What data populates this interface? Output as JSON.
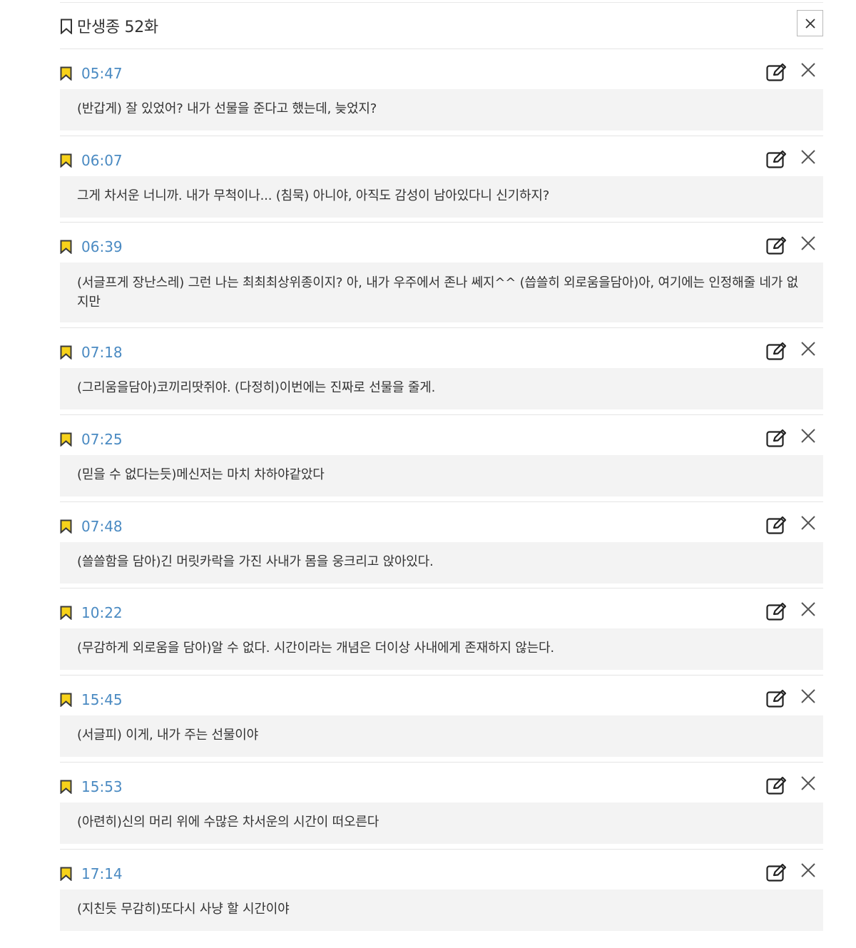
{
  "header": {
    "title": "만생종 52화"
  },
  "colors": {
    "timestamp": "#4a8ac2",
    "bookmark_fill": "#f7d21a",
    "bookmark_stroke": "#3a3a3a",
    "note_background": "#f3f3f3"
  },
  "icons": {
    "header": "bookmark-outline-icon",
    "entry": "bookmark-filled-icon",
    "edit": "edit-icon",
    "delete": "close-icon"
  },
  "bookmarks": [
    {
      "time": "05:47",
      "note": "(반갑게) 잘 있었어? 내가 선물을 준다고 했는데, 늦었지?"
    },
    {
      "time": "06:07",
      "note": "그게 차서운 너니까. 내가 무척이나... (침묵) 아니야, 아직도 감성이 남아있다니 신기하지?"
    },
    {
      "time": "06:39",
      "note": "(서글프게 장난스레) 그런 나는 최최최상위종이지? 아, 내가 우주에서 존나 쎄지^^ (씁쓸히 외로움을담아)아, 여기에는 인정해줄 네가 없지만"
    },
    {
      "time": "07:18",
      "note": "(그리움을담아)코끼리땃쥐야. (다정히)이번에는 진짜로 선물을 줄게."
    },
    {
      "time": "07:25",
      "note": "(믿을 수 없다는듯)메신저는 마치 차하야같았다"
    },
    {
      "time": "07:48",
      "note": "(쓸쓸함을 담아)긴 머릿카락을 가진 사내가 몸을 웅크리고 앉아있다."
    },
    {
      "time": "10:22",
      "note": "(무감하게 외로움을 담아)알 수 없다. 시간이라는 개념은 더이상 사내에게 존재하지 않는다."
    },
    {
      "time": "15:45",
      "note": "(서글피) 이게, 내가 주는 선물이야"
    },
    {
      "time": "15:53",
      "note": "(아련히)신의 머리 위에 수많은 차서운의 시간이 떠오른다"
    },
    {
      "time": "17:14",
      "note": "(지친듯 무감히)또다시 사냥 할 시간이야"
    }
  ]
}
